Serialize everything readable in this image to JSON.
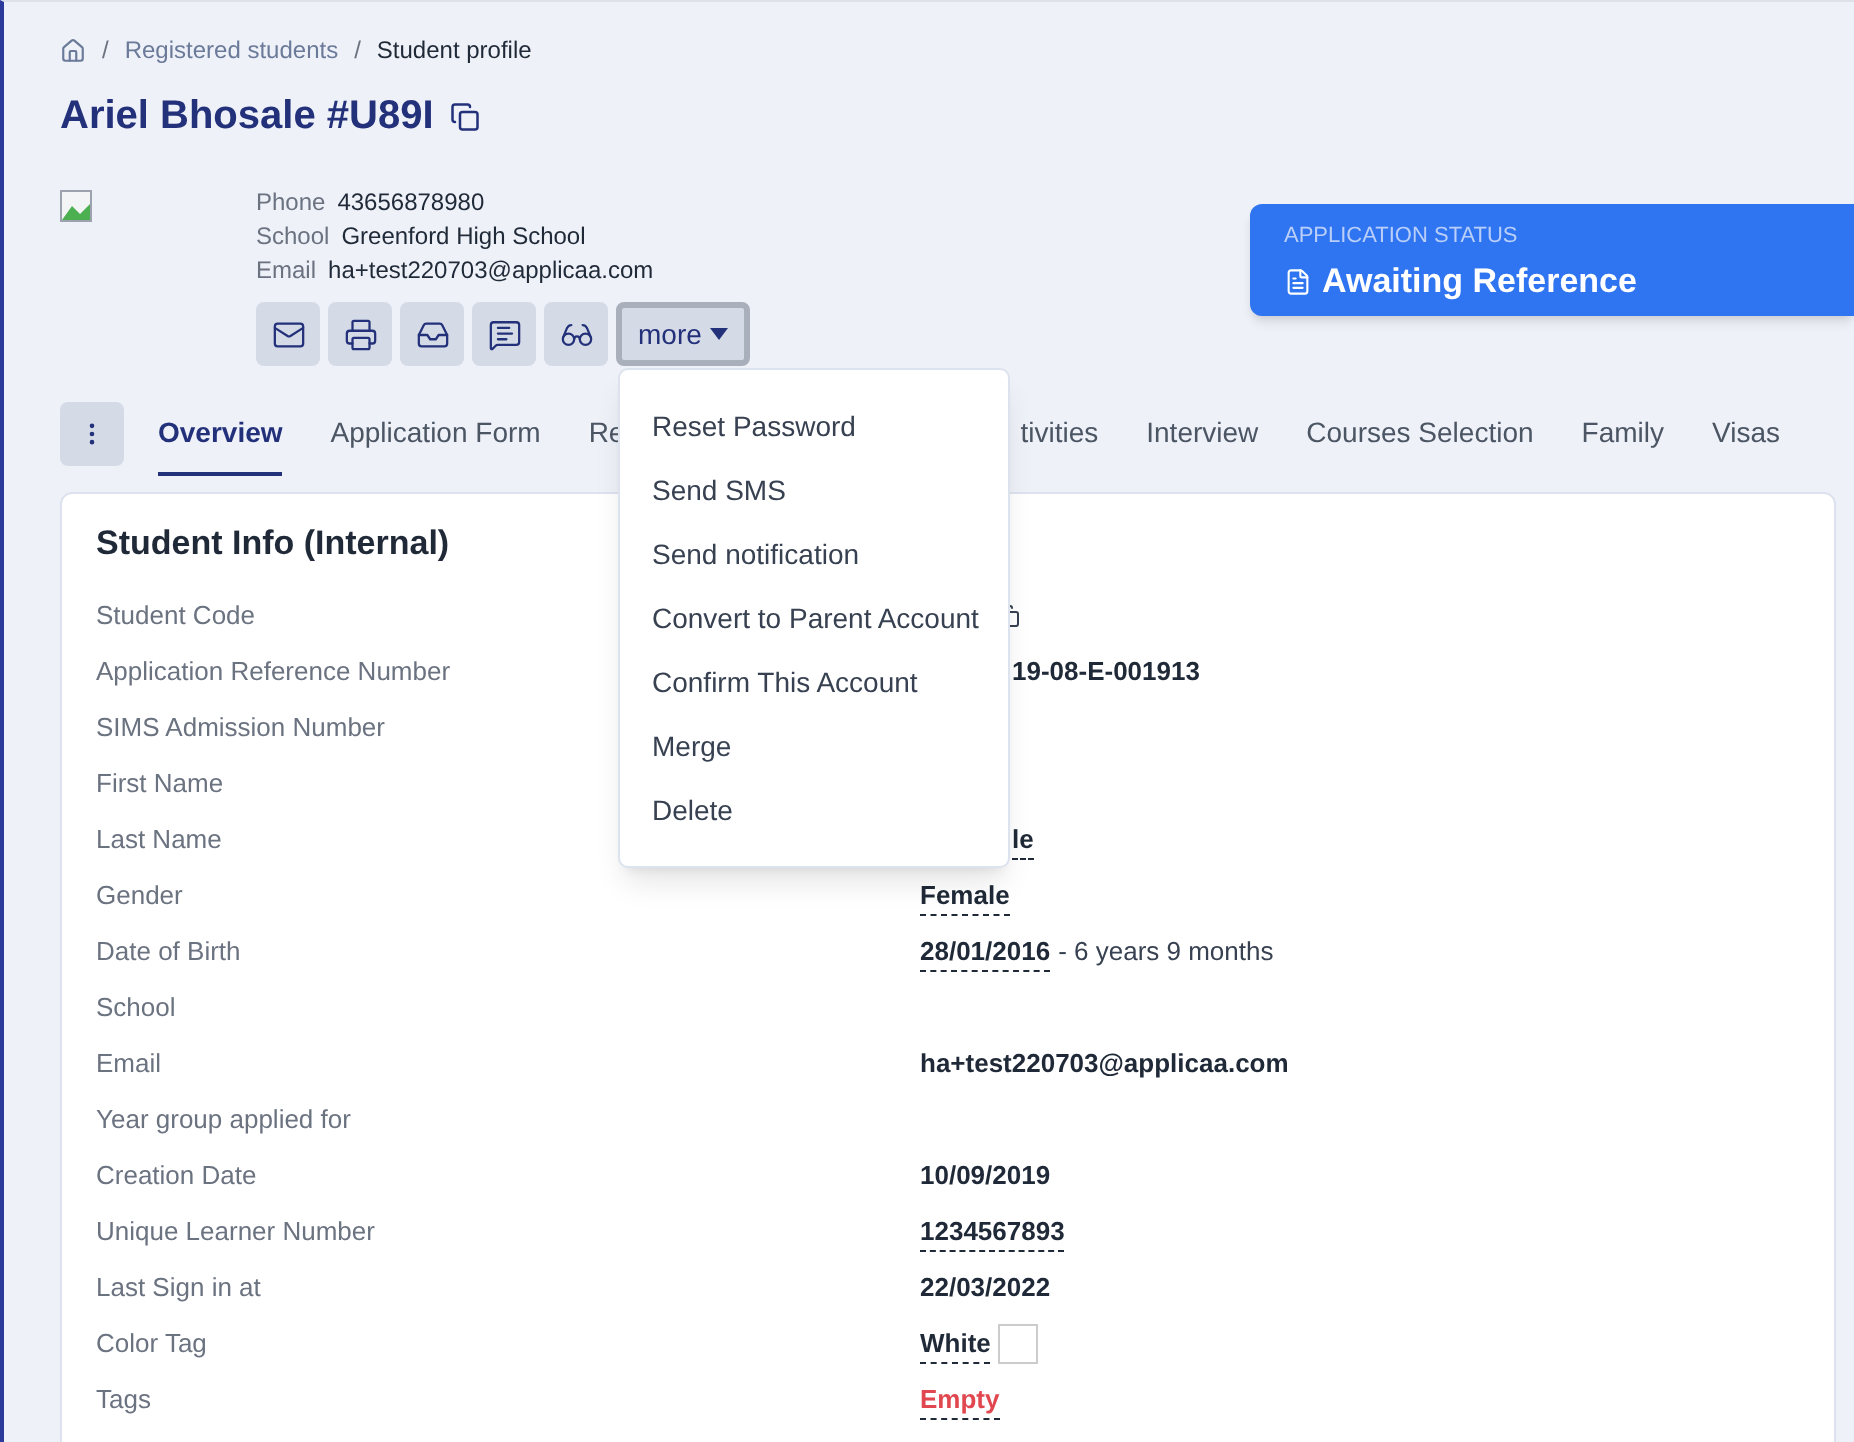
{
  "breadcrumb_separator": "/",
  "breadcrumb": [
    "Registered students",
    "Student profile"
  ],
  "title": "Ariel Bhosale #U89I",
  "contact": [
    {
      "label": "Phone",
      "value": "43656878980"
    },
    {
      "label": "School",
      "value": "Greenford High School"
    },
    {
      "label": "Email",
      "value": "ha+test220703@applicaa.com"
    }
  ],
  "more_button": {
    "label": "more",
    "expanded": true
  },
  "application_status": {
    "label": "APPLICATION STATUS",
    "value": "Awaiting Reference"
  },
  "tabs": [
    {
      "label": "Overview",
      "selected": true
    },
    {
      "label": "Application Form",
      "selected": false
    },
    {
      "label": "Re",
      "selected": false
    },
    {
      "label": "tivities",
      "selected": false,
      "clipped": true
    },
    {
      "label": "Interview",
      "selected": false
    },
    {
      "label": "Courses Selection",
      "selected": false
    },
    {
      "label": "Family",
      "selected": false
    },
    {
      "label": "Visas",
      "selected": false
    }
  ],
  "menu": [
    "Reset Password",
    "Send SMS",
    "Send notification",
    "Convert to Parent Account",
    "Confirm This Account",
    "Merge",
    "Delete"
  ],
  "card_title": "Student Info (Internal)",
  "rows": [
    {
      "label": "Student Code",
      "kind": "copy",
      "clipped": true
    },
    {
      "label": "Application Reference Number",
      "value": "19-08-E-001913",
      "clipped": true,
      "kind": "text"
    },
    {
      "label": "SIMS Admission Number",
      "kind": "text"
    },
    {
      "label": "First Name",
      "kind": "text"
    },
    {
      "label": "Last Name",
      "value": "le",
      "clipped": true,
      "underline": true,
      "kind": "text"
    },
    {
      "label": "Gender",
      "value": "Female",
      "underline": true,
      "kind": "text"
    },
    {
      "label": "Date of Birth",
      "value": "28/01/2016",
      "underline": true,
      "suffix": "- 6 years 9 months",
      "kind": "text"
    },
    {
      "label": "School",
      "kind": "text"
    },
    {
      "label": "Email",
      "value": "ha+test220703@applicaa.com",
      "kind": "text"
    },
    {
      "label": "Year group applied for",
      "kind": "text"
    },
    {
      "label": "Creation Date",
      "value": "10/09/2019",
      "kind": "text"
    },
    {
      "label": "Unique Learner Number",
      "value": "1234567893",
      "underline": true,
      "kind": "text"
    },
    {
      "label": "Last Sign in at",
      "value": "22/03/2022",
      "kind": "text"
    },
    {
      "label": "Color Tag",
      "value": "White",
      "underline": true,
      "kind": "swatch",
      "color": "#ffffff"
    },
    {
      "label": "Tags",
      "value": "Empty",
      "underline": true,
      "kind": "danger"
    }
  ]
}
